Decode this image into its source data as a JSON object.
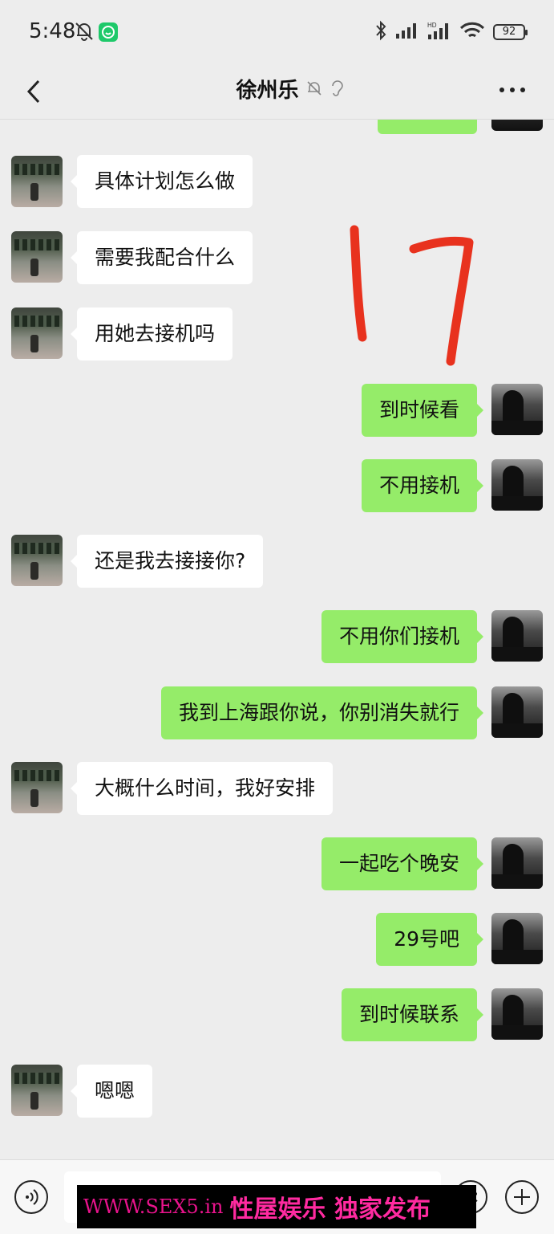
{
  "status_bar": {
    "time": "5:48",
    "battery": "92",
    "icons": [
      "bell-off-icon",
      "app-notification-icon",
      "bluetooth-icon",
      "signal-icon",
      "hd-signal-icon",
      "wifi-icon",
      "battery-icon"
    ]
  },
  "nav": {
    "back_icon": "chevron-left-icon",
    "title": "徐州乐",
    "title_icons": [
      "mute-icon",
      "ear-icon"
    ],
    "more_icon": "more-dots-icon"
  },
  "annotation": {
    "handwritten_text": "17",
    "color": "#e8321e"
  },
  "messages": [
    {
      "sender": "me",
      "text": ""
    },
    {
      "sender": "them",
      "text": "具体计划怎么做"
    },
    {
      "sender": "them",
      "text": "需要我配合什么"
    },
    {
      "sender": "them",
      "text": "用她去接机吗"
    },
    {
      "sender": "me",
      "text": "到时候看"
    },
    {
      "sender": "me",
      "text": "不用接机"
    },
    {
      "sender": "them",
      "text": "还是我去接接你?"
    },
    {
      "sender": "me",
      "text": "不用你们接机"
    },
    {
      "sender": "me",
      "text": "我到上海跟你说，你别消失就行"
    },
    {
      "sender": "them",
      "text": "大概什么时间，我好安排"
    },
    {
      "sender": "me",
      "text": "一起吃个晚安"
    },
    {
      "sender": "me",
      "text": "29号吧"
    },
    {
      "sender": "me",
      "text": "到时候联系"
    },
    {
      "sender": "them",
      "text": "嗯嗯"
    }
  ],
  "input_bar": {
    "voice_icon": "voice-icon",
    "emoji_icon": "emoji-icon",
    "plus_icon": "plus-icon",
    "input_value": ""
  },
  "watermark": {
    "url": "WWW.SEX5.in",
    "slogan": "性屋娱乐 独家发布"
  },
  "colors": {
    "background": "#ededed",
    "my_bubble": "#95ec69",
    "their_bubble": "#ffffff",
    "watermark_bg": "#000000",
    "watermark_text": "#e8138c"
  }
}
